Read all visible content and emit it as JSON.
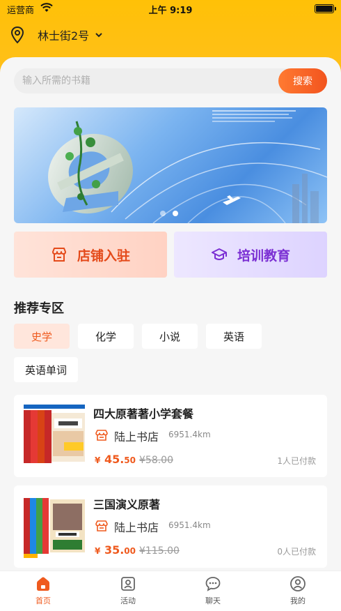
{
  "status_bar": {
    "carrier": "运营商",
    "time": "上午 9:19"
  },
  "location": {
    "text": "林士街2号"
  },
  "search": {
    "placeholder": "输入所需的书籍",
    "button_label": "搜索"
  },
  "quick_entries": [
    {
      "label": "店铺入驻",
      "icon": "store-icon"
    },
    {
      "label": "培训教育",
      "icon": "graduation-cap-icon"
    }
  ],
  "section_title": "推荐专区",
  "categories": [
    {
      "label": "史学",
      "active": true
    },
    {
      "label": "化学",
      "active": false
    },
    {
      "label": "小说",
      "active": false
    },
    {
      "label": "英语",
      "active": false
    },
    {
      "label": "英语单词",
      "active": false
    }
  ],
  "books": [
    {
      "title": "四大原著著小学套餐",
      "shop": "陆上书店",
      "distance": "6951.4km",
      "price_symbol": "¥",
      "price_int": "45.",
      "price_dec": "50",
      "original_price": "¥58.00",
      "paid": "1人已付款"
    },
    {
      "title": "三国演义原著",
      "shop": "陆上书店",
      "distance": "6951.4km",
      "price_symbol": "¥",
      "price_int": "35.",
      "price_dec": "00",
      "original_price": "¥115.00",
      "paid": "0人已付款"
    }
  ],
  "tabs": [
    {
      "label": "首页",
      "icon": "home-icon",
      "active": true
    },
    {
      "label": "活动",
      "icon": "activity-icon",
      "active": false
    },
    {
      "label": "聊天",
      "icon": "chat-icon",
      "active": false
    },
    {
      "label": "我的",
      "icon": "profile-icon",
      "active": false
    }
  ],
  "colors": {
    "accent": "#ef5a1e",
    "header": "#ffc107",
    "training": "#7b2fd3"
  }
}
